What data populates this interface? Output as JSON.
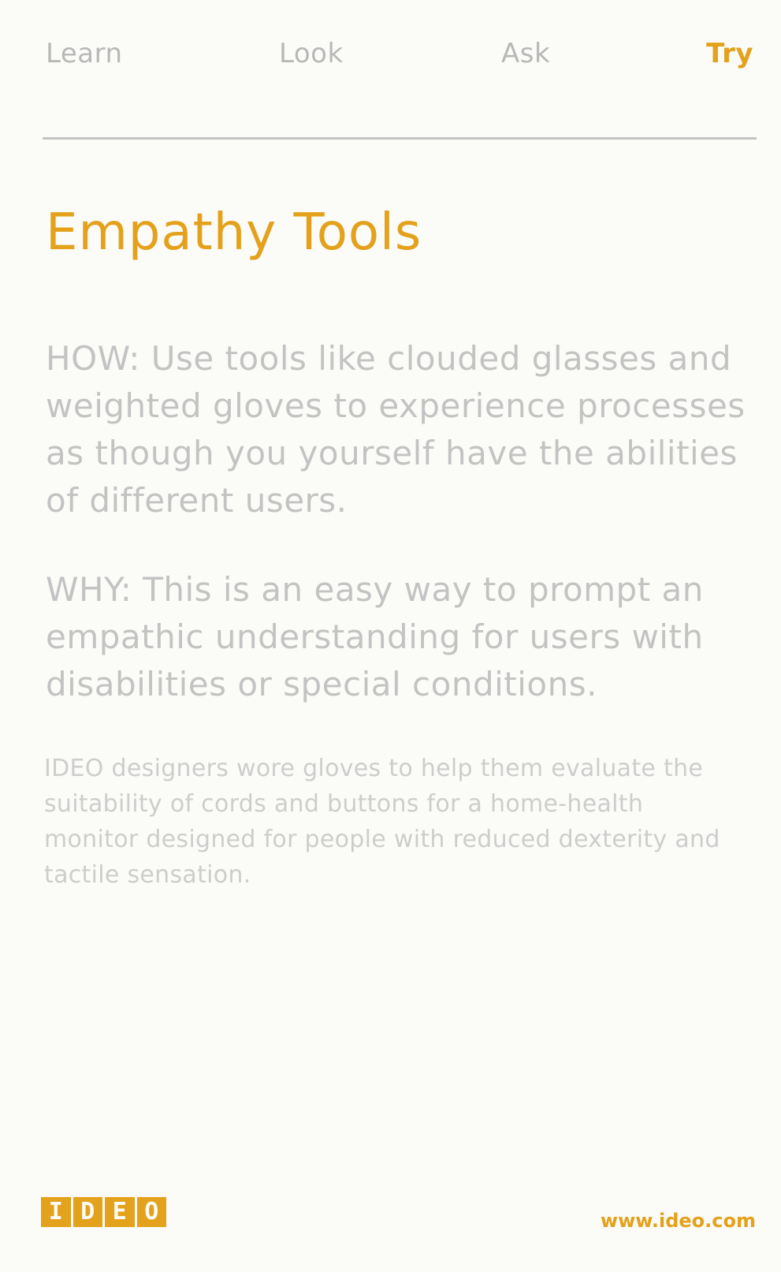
{
  "nav": {
    "items": [
      "Learn",
      "Look",
      "Ask",
      "Try"
    ],
    "active": "Try"
  },
  "card": {
    "title": "Empathy Tools",
    "how": "HOW: Use tools like clouded glasses and weighted gloves to experience processes as though you yourself have the abilities of different users.",
    "why": "WHY: This is an easy way to prompt an empathic understanding for users with disabilities or special conditions.",
    "note": "IDEO designers wore gloves to help them evaluate the suitability of cords and buttons for a home-health monitor designed for people with reduced dexterity and tactile sensation."
  },
  "footer": {
    "logo_text": "IDEO",
    "logo_letters": [
      "I",
      "D",
      "E",
      "O"
    ],
    "url": "www.ideo.com"
  },
  "colors": {
    "accent": "#e4a11b",
    "body_text": "#c3c3c3",
    "nav_text": "#b8b8b8",
    "background": "#fbfbf8"
  }
}
